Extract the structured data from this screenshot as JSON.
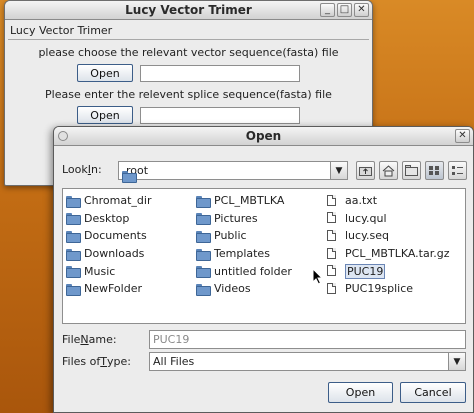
{
  "main_window": {
    "title": "Lucy Vector Trimer",
    "frame_title": "Lucy Vector Trimer",
    "prompt_vector": "please choose the relevant vector sequence(fasta) file",
    "open_label_1": "Open",
    "prompt_splice": "Please enter the relevent splice sequence(fasta) file",
    "open_label_2": "Open",
    "controls": {
      "minimize": "_",
      "maximize": "□",
      "close": "✕"
    }
  },
  "dialog": {
    "title": "Open",
    "look_in_prefix": "Look ",
    "look_in_access": "I",
    "look_in_suffix": "n:",
    "look_in_value": "root",
    "controls": {
      "close": "✕"
    },
    "columns": [
      [
        {
          "name": "Chromat_dir",
          "kind": "folder"
        },
        {
          "name": "Desktop",
          "kind": "folder"
        },
        {
          "name": "Documents",
          "kind": "folder"
        },
        {
          "name": "Downloads",
          "kind": "folder"
        },
        {
          "name": "Music",
          "kind": "folder"
        },
        {
          "name": "NewFolder",
          "kind": "folder"
        }
      ],
      [
        {
          "name": "PCL_MBTLKA",
          "kind": "folder"
        },
        {
          "name": "Pictures",
          "kind": "folder"
        },
        {
          "name": "Public",
          "kind": "folder"
        },
        {
          "name": "Templates",
          "kind": "folder"
        },
        {
          "name": "untitled folder",
          "kind": "folder"
        },
        {
          "name": "Videos",
          "kind": "folder"
        }
      ],
      [
        {
          "name": "aa.txt",
          "kind": "file"
        },
        {
          "name": "lucy.qul",
          "kind": "file"
        },
        {
          "name": "lucy.seq",
          "kind": "file"
        },
        {
          "name": "PCL_MBTLKA.tar.gz",
          "kind": "file"
        },
        {
          "name": "PUC19",
          "kind": "file",
          "selected": true
        },
        {
          "name": "PUC19splice",
          "kind": "file"
        }
      ]
    ],
    "file_name_prefix": "File ",
    "file_name_access": "N",
    "file_name_suffix": "ame:",
    "file_name_value": "PUC19",
    "files_of_type_prefix": "Files of ",
    "files_of_type_access": "T",
    "files_of_type_suffix": "ype:",
    "files_of_type_value": "All Files",
    "open_button": "Open",
    "cancel_button": "Cancel"
  }
}
